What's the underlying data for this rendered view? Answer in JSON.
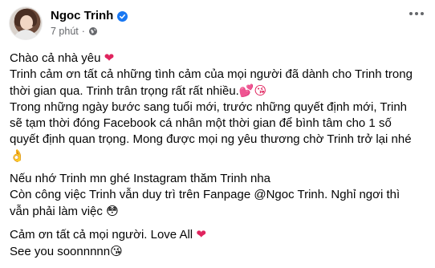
{
  "header": {
    "author": "Ngoc Trinh",
    "time": "7 phút",
    "separator": "·"
  },
  "post": {
    "p1_l1": "Chào cả nhà yêu",
    "p1_l2": "Trinh cảm ơn tất cả những tình cảm của mọi người đã dành cho Trinh trong",
    "p1_l3": "thời gian qua. Trinh trân trọng rất rất nhiều.",
    "p1_l4": "Trong những ngày bước sang tuổi mới, trước những quyết định mới, Trinh",
    "p1_l5": "sẽ tạm thời đóng Facebook cá nhân một thời gian để bình tâm cho 1 số",
    "p1_l6": "quyết định quan trọng. Mong được mọi ng yêu thương chờ Trinh trở lại nhé",
    "p2_l1": "Nếu nhớ Trinh mn ghé Instagram thăm Trinh nha",
    "p2_l2": "Còn công việc Trinh vẫn duy trì trên Fanpage @Ngoc Trinh. Nghỉ ngơi thì",
    "p2_l3": "vẫn phải làm việc",
    "p3_l1": "Cảm ơn tất cả mọi người. Love All",
    "p3_l2": "See you soonnnnn"
  },
  "icons": {
    "verified": "verified-badge-icon",
    "privacy": "globe-icon",
    "more": "more-options-icon",
    "emoji_heart": "red-heart-emoji",
    "emoji_hearts_kiss": "two-hearts-kiss-emoji",
    "emoji_ok": "ok-hand-emoji",
    "emoji_flushed": "peeking-face-emoji",
    "emoji_kiss": "blowing-kiss-emoji"
  },
  "colors": {
    "accent": "#1877f2",
    "meta_text": "#65676b",
    "heart": "#e0245e"
  }
}
